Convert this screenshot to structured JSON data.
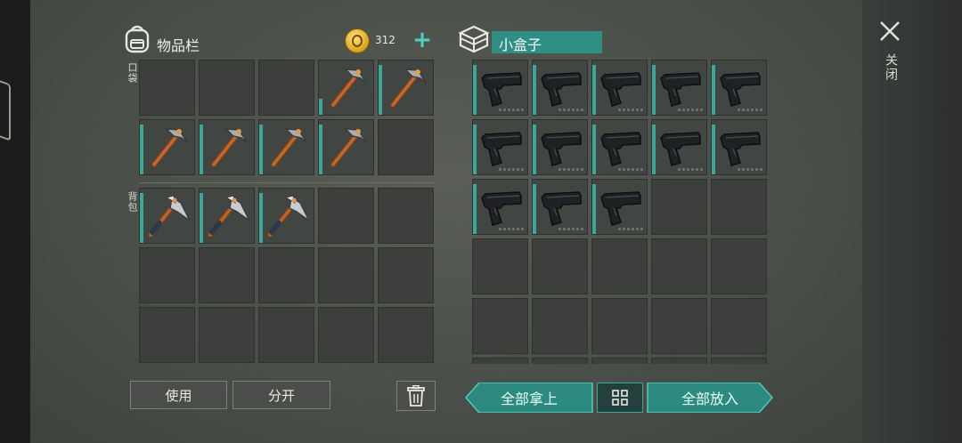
{
  "inventory": {
    "title": "物品栏",
    "coins": "312",
    "pocket_label": "口袋",
    "backpack_label": "背包",
    "pocket_slots": [
      "empty",
      "empty",
      "empty",
      "pickaxe",
      "pickaxe",
      "pickaxe",
      "pickaxe",
      "pickaxe",
      "pickaxe",
      "empty"
    ],
    "backpack_slots": [
      "hatchet",
      "hatchet",
      "hatchet",
      "empty",
      "empty",
      "empty",
      "empty",
      "empty",
      "empty",
      "empty",
      "empty",
      "empty",
      "empty",
      "empty",
      "empty"
    ]
  },
  "container": {
    "title": "小盒子",
    "slots": [
      "pistol",
      "pistol",
      "pistol",
      "pistol",
      "pistol",
      "pistol",
      "pistol",
      "pistol",
      "pistol",
      "pistol",
      "pistol",
      "pistol",
      "pistol",
      "empty",
      "empty",
      "empty",
      "empty",
      "empty",
      "empty",
      "empty",
      "empty",
      "empty",
      "empty",
      "empty",
      "empty",
      "empty",
      "empty",
      "empty",
      "empty",
      "empty"
    ]
  },
  "actions": {
    "use": "使用",
    "split": "分开",
    "take_all": "全部拿上",
    "put_all": "全部放入"
  },
  "close_label": "关闭",
  "icons": {
    "backpack": "backpack-icon",
    "coin": "coin-icon",
    "add": "plus-icon",
    "box": "box-icon",
    "trash": "trash-icon",
    "sort": "grid-sort-icon",
    "close": "close-icon"
  },
  "colors": {
    "accent": "#3aa79a",
    "teal_button": "#2c8a80",
    "coin": "#e0a92a"
  }
}
